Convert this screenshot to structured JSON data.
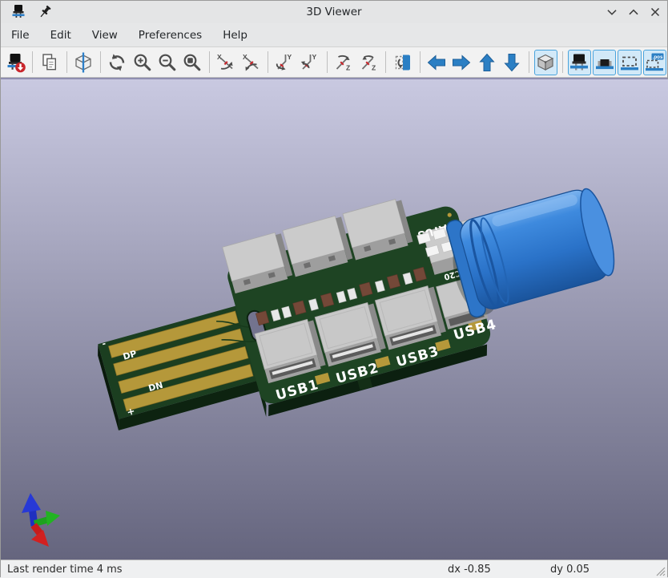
{
  "window": {
    "title": "3D Viewer",
    "icon": "3d-viewer-capacitor-icon",
    "pin_icon": "pin-icon",
    "controls": {
      "minimize": "chevron-down",
      "maximize": "chevron-up",
      "close": "x"
    }
  },
  "menu_bar": {
    "items": [
      "File",
      "Edit",
      "View",
      "Preferences",
      "Help"
    ]
  },
  "toolbar": {
    "pos_badge": ".pos",
    "axis_labels": {
      "x": "X",
      "y": "Y",
      "z": "Z"
    },
    "buttons": [
      {
        "name": "reload-board",
        "active": false
      },
      {
        "name": "copy-image",
        "active": false
      },
      {
        "name": "render-engine-cube",
        "active": false
      },
      {
        "name": "redraw-view",
        "active": false
      },
      {
        "name": "zoom-in",
        "active": false
      },
      {
        "name": "zoom-out",
        "active": false
      },
      {
        "name": "zoom-to-fit",
        "active": false
      },
      {
        "name": "rotate-x-clockwise",
        "active": false
      },
      {
        "name": "rotate-x-counterclockwise",
        "active": false
      },
      {
        "name": "rotate-y-clockwise",
        "active": false
      },
      {
        "name": "rotate-y-counterclockwise",
        "active": false
      },
      {
        "name": "rotate-z-clockwise",
        "active": false
      },
      {
        "name": "rotate-z-counterclockwise",
        "active": false
      },
      {
        "name": "flip-board",
        "active": false
      },
      {
        "name": "move-left",
        "active": false
      },
      {
        "name": "move-right",
        "active": false
      },
      {
        "name": "move-up",
        "active": false
      },
      {
        "name": "move-down",
        "active": false
      },
      {
        "name": "orthographic-projection",
        "active": true
      },
      {
        "name": "show-through-hole-models",
        "active": true
      },
      {
        "name": "show-smd-models",
        "active": true
      },
      {
        "name": "show-virtual-models",
        "active": true
      },
      {
        "name": "show-pos-models",
        "active": true
      }
    ]
  },
  "viewport": {
    "background": {
      "top": "#c9c9e1",
      "bottom": "#65657e"
    },
    "board": {
      "silkscreen": {
        "usb1": "USB1",
        "usb2": "USB2",
        "usb3": "USB3",
        "usb4": "USB4",
        "status": "STATUS",
        "c20": "C20",
        "dp": "DP",
        "dn": "DN",
        "minus": "-",
        "plus": "+"
      },
      "colors": {
        "pcb_top": "#1e4423",
        "pcb_side": "#0c2010",
        "gold": "#b5983a",
        "connector": "#c8c8c8",
        "capacitor": "#2f7fd4",
        "silkscreen": "#ffffff"
      }
    },
    "axis_gizmo": {
      "x_color": "#d22020",
      "y_color": "#22b322",
      "z_color": "#2739d6"
    }
  },
  "status_bar": {
    "render_time": "Last render time 4 ms",
    "dx": "dx -0.85",
    "dy": "dy 0.05"
  }
}
